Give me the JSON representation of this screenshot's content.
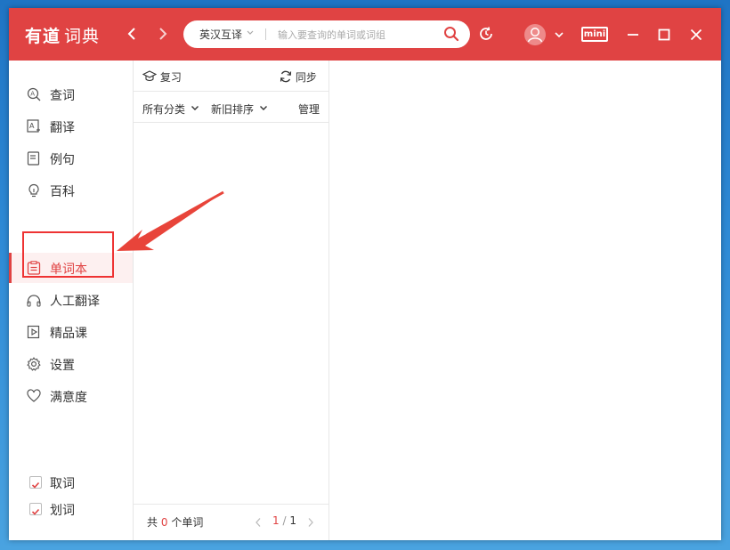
{
  "app": {
    "logo_brand": "有道",
    "logo_name": "词典",
    "accent_color": "#e04343"
  },
  "titlebar": {
    "back_icon": "chevron-left-icon",
    "forward_icon": "chevron-right-icon",
    "search": {
      "mode": "英汉互译",
      "placeholder": "输入要查询的单词或词组",
      "value": ""
    },
    "history_icon": "history-icon",
    "avatar_icon": "user-avatar-icon",
    "mini_label": "mini",
    "window_controls": [
      "minimize-icon",
      "maximize-icon",
      "close-icon"
    ]
  },
  "sidebar": {
    "items": [
      {
        "label": "查词",
        "icon": "lookup-icon"
      },
      {
        "label": "翻译",
        "icon": "translate-icon"
      },
      {
        "label": "例句",
        "icon": "sentence-icon"
      },
      {
        "label": "百科",
        "icon": "bulb-icon"
      },
      {
        "label": "单词本",
        "icon": "wordbook-icon",
        "active": true
      },
      {
        "label": "人工翻译",
        "icon": "human-translate-icon"
      },
      {
        "label": "精品课",
        "icon": "course-icon"
      },
      {
        "label": "设置",
        "icon": "gear-icon"
      },
      {
        "label": "满意度",
        "icon": "heart-icon"
      }
    ],
    "checks": [
      {
        "label": "取词",
        "checked": true
      },
      {
        "label": "划词",
        "checked": true
      }
    ]
  },
  "wordbook": {
    "review_label": "复习",
    "sync_label": "同步",
    "category_filter": "所有分类",
    "sort_filter": "新旧排序",
    "manage_label": "管理",
    "footer": {
      "prefix": "共",
      "count": "0",
      "suffix": "个单词",
      "page_current": "1",
      "page_sep": "/",
      "page_total": "1"
    }
  }
}
